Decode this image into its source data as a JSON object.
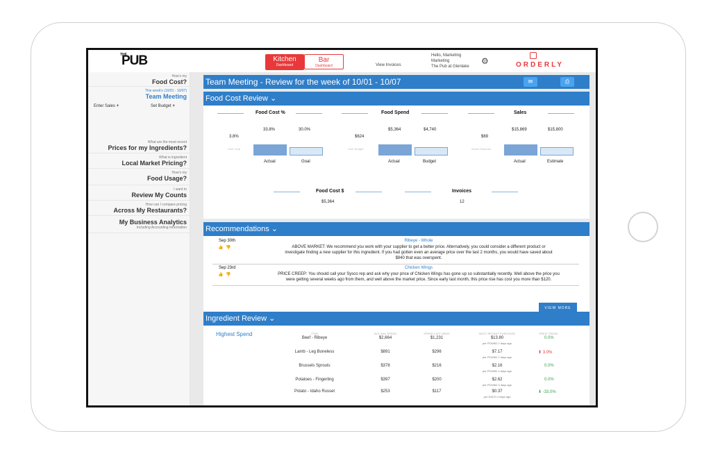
{
  "header": {
    "logo_text": "PUB",
    "logo_small": "THE",
    "kitchen": {
      "title": "Kitchen",
      "sub": "Dashboard"
    },
    "bar": {
      "title": "Bar",
      "sub": "Dashboard"
    },
    "view_invoices": "View Invoices",
    "user": {
      "line1": "Hello, Marketing",
      "line2": "Marketing",
      "line3": "The Pub at Glenlake"
    },
    "brand": "ORDERLY"
  },
  "sidebar": {
    "items": [
      {
        "small": "How's my",
        "big": "Food Cost?"
      },
      {
        "small": "This week's (10/01 - 10/07)",
        "big": "Team Meeting"
      },
      {
        "small": "What are the most recent",
        "big": "Prices for my Ingredients?"
      },
      {
        "small": "What is ingredient",
        "big": "Local Market Pricing?"
      },
      {
        "small": "How's my",
        "big": "Food Usage?"
      },
      {
        "small": "I want to",
        "big": "Review My Counts"
      },
      {
        "small": "How can I compare pricing",
        "big": "Across My Restaurants?"
      },
      {
        "small": "Including Accounting Information",
        "big": "My Business Analytics"
      }
    ],
    "enter_sales": "Enter Sales",
    "set_budget": "Set Budget"
  },
  "main": {
    "title": "Team Meeting - Review for the week of 10/01 - 10/07",
    "food_cost_review": {
      "title": "Food Cost Review",
      "food_cost_pct": {
        "label": "Food Cost %",
        "actual_val": "33.8%",
        "goal_val": "30.0%",
        "left_val": "3.8%",
        "ghost": "Over Goal",
        "actual_cap": "Actual",
        "goal_cap": "Goal"
      },
      "food_spend": {
        "label": "Food Spend",
        "actual_val": "$5,364",
        "budget_val": "$4,740",
        "left_val": "$624",
        "ghost": "Over Budget",
        "actual_cap": "Actual",
        "budget_cap": "Budget"
      },
      "sales": {
        "label": "Sales",
        "actual_val": "$15,869",
        "estimate_val": "$15,800",
        "left_val": "$69",
        "ghost": "Above Estimate",
        "actual_cap": "Actual",
        "estimate_cap": "Estimate"
      },
      "food_cost_dollar": {
        "label": "Food Cost $",
        "value": "$5,364"
      },
      "invoices": {
        "label": "Invoices",
        "value": "12"
      }
    },
    "recommendations": {
      "title": "Recommendations",
      "items": [
        {
          "date": "Sep 30th",
          "item": "Ribeye - Whole",
          "text_line1": "ABOVE MARKET: We recommend you work with your supplier to get a better price. Alternatively, you could consider a different product or",
          "text_line2": "investigate finding a new supplier for this ingredient. If you had gotten even an average price over the last 2 months, you would have saved about",
          "text_line3": "$940 that was overspent."
        },
        {
          "date": "Sep 23rd",
          "item": "Chicken Wings",
          "text_line1": "PRICE CREEP: You should call your Sysco rep and ask why your price of Chicken Wings has gone up so substantially recently. Well above the price you",
          "text_line2": "were getting several weeks ago from them, and well above the market price. Since early last month, this price rise has cost you more than $120.",
          "text_line3": ""
        }
      ],
      "view_more": "VIEW MORE"
    },
    "ingredient_review": {
      "title": "Ingredient Review",
      "highest_spend": "Highest Spend",
      "columns": [
        "ITEM",
        "AVG WKL SPEND",
        "SPEND LAST WEEK",
        "MOST RECENT PURCHASE",
        "PRICE TREND"
      ],
      "rows": [
        {
          "item": "Beef - Ribeye",
          "avg": "$2,664",
          "last": "$1,231",
          "recent": "$13.80",
          "recent_sub": "per POUND 2 days ago",
          "trend": "0.0%"
        },
        {
          "item": "Lamb - Leg Boneless",
          "avg": "$891",
          "last": "$296",
          "recent": "$7.17",
          "recent_sub": "per POUND 2 days ago",
          "trend": "3.0%"
        },
        {
          "item": "Brussels Sprouts",
          "avg": "$378",
          "last": "$216",
          "recent": "$2.16",
          "recent_sub": "per POUND 4 days ago",
          "trend": "0.0%"
        },
        {
          "item": "Potatoes - Fingerling",
          "avg": "$397",
          "last": "$200",
          "recent": "$2.62",
          "recent_sub": "per POUND 3 days ago",
          "trend": "0.0%"
        },
        {
          "item": "Potato - Idaho Russet",
          "avg": "$253",
          "last": "$117",
          "recent": "$0.37",
          "recent_sub": "per EACH 4 days ago",
          "trend": "-33.0%"
        }
      ]
    }
  },
  "colors": {
    "accent": "#2f7ec9",
    "brand_red": "#e8383a",
    "positive": "#3aa04a"
  }
}
